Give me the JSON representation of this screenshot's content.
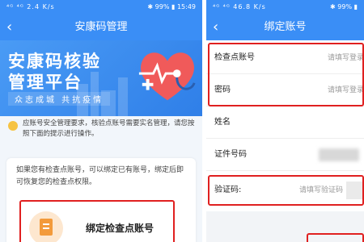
{
  "colors": {
    "primary": "#3a8ef6",
    "highlight": "#e02020",
    "heart": "#f05a5a",
    "icon_bg": "#fde7cf",
    "icon": "#f39a3a"
  },
  "left": {
    "status": {
      "left": "⁴ᴳ ⁴ᴳ 2.4 K/s",
      "right": "✱ 99% ▮ 15:49"
    },
    "nav": {
      "back_icon": "‹",
      "title": "安康码管理"
    },
    "banner": {
      "line1": "安康码核验",
      "line2": "管理平台",
      "slogan": "众志成城 共抗疫情"
    },
    "notice": "应账号安全管理要求，核验点账号需要实名管理，请您按照下面的提示进行操作。",
    "card": {
      "desc": "如果您有检查点账号，可以绑定已有账号，绑定后即可恢复您的检查点权限。",
      "bind_label": "绑定检查点账号"
    }
  },
  "right": {
    "status": {
      "left": "⁴ᴳ ⁴ᴳ 46.8 K/s",
      "right": "✱ 99% ▮"
    },
    "nav": {
      "back_icon": "‹",
      "title": "绑定账号"
    },
    "fields": [
      {
        "label": "检查点账号",
        "placeholder": "请填写登录"
      },
      {
        "label": "密码",
        "placeholder": "请填写登录"
      },
      {
        "label": "姓名",
        "placeholder": ""
      },
      {
        "label": "证件号码",
        "placeholder": ""
      },
      {
        "label": "验证码:",
        "placeholder": "请填写验证码"
      }
    ]
  }
}
